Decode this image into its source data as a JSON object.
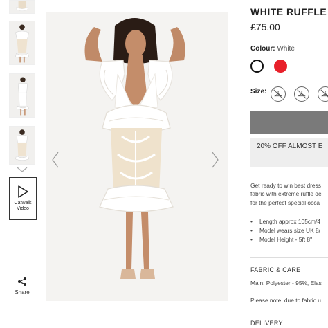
{
  "product": {
    "title": "WHITE RUFFLE DE",
    "price": "£75.00"
  },
  "colour": {
    "label": "Colour:",
    "selected": "White",
    "swatches": [
      {
        "name": "White",
        "hex": "#ffffff"
      },
      {
        "name": "Red",
        "hex": "#e8202a"
      }
    ]
  },
  "size": {
    "label": "Size:"
  },
  "promo": {
    "text": "20% OFF ALMOST E"
  },
  "description": {
    "lines": [
      "Get ready to win best dress",
      "fabric with extreme ruffle de",
      "for the perfect special occa"
    ],
    "bullets": [
      "Length approx 105cm/4",
      "Model wears size UK 8/",
      "Model Height - 5ft 8\""
    ]
  },
  "fabric": {
    "heading": "FABRIC & CARE",
    "main": "Main: Polyester - 95%, Elas",
    "note": "Please note: due to fabric u"
  },
  "delivery": {
    "heading": "DELIVERY"
  },
  "gallery": {
    "catwalk_label_1": "Catwalk",
    "catwalk_label_2": "Video",
    "share_label": "Share"
  },
  "colors": {
    "accent_red": "#e8202a",
    "button_grey": "#7a7a7a",
    "promo_bg": "#eeeeee"
  }
}
